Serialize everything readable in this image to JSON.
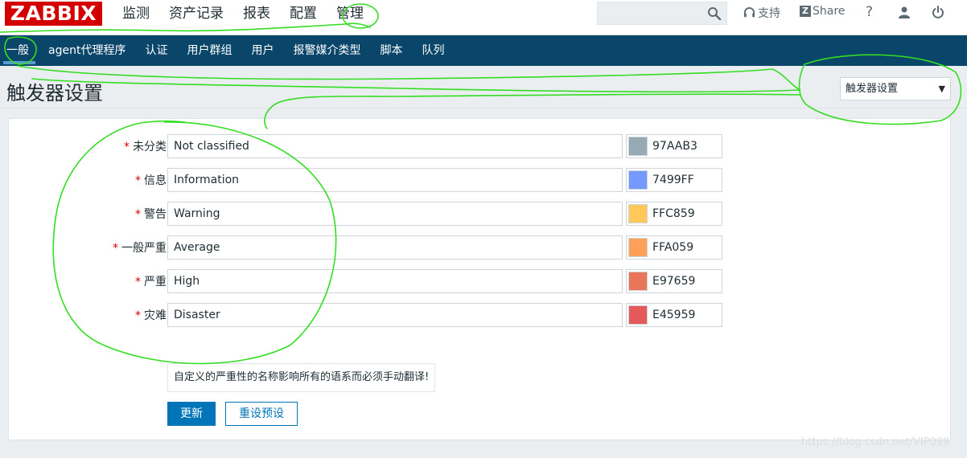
{
  "logo": "ZABBIX",
  "main_nav": [
    "监测",
    "资产记录",
    "报表",
    "配置",
    "管理"
  ],
  "toolbar": {
    "search_placeholder": "",
    "support": "支持",
    "share": "Share",
    "help": "?"
  },
  "sub_nav": [
    "一般",
    "agent代理程序",
    "认证",
    "用户群组",
    "用户",
    "报警媒介类型",
    "脚本",
    "队列"
  ],
  "page": {
    "title": "触发器设置",
    "select_value": "触发器设置"
  },
  "severities": [
    {
      "label": "未分类",
      "name": "Not classified",
      "color": "97AAB3"
    },
    {
      "label": "信息",
      "name": "Information",
      "color": "7499FF"
    },
    {
      "label": "警告",
      "name": "Warning",
      "color": "FFC859"
    },
    {
      "label": "一般严重",
      "name": "Average",
      "color": "FFA059"
    },
    {
      "label": "严重",
      "name": "High",
      "color": "E97659"
    },
    {
      "label": "灾难",
      "name": "Disaster",
      "color": "E45959"
    }
  ],
  "required_mark": "*",
  "note": "自定义的严重性的名称影响所有的语系而必须手动翻译!",
  "buttons": {
    "update": "更新",
    "reset": "重设预设"
  },
  "watermark": "https://blog.csdn.net/VIP099"
}
